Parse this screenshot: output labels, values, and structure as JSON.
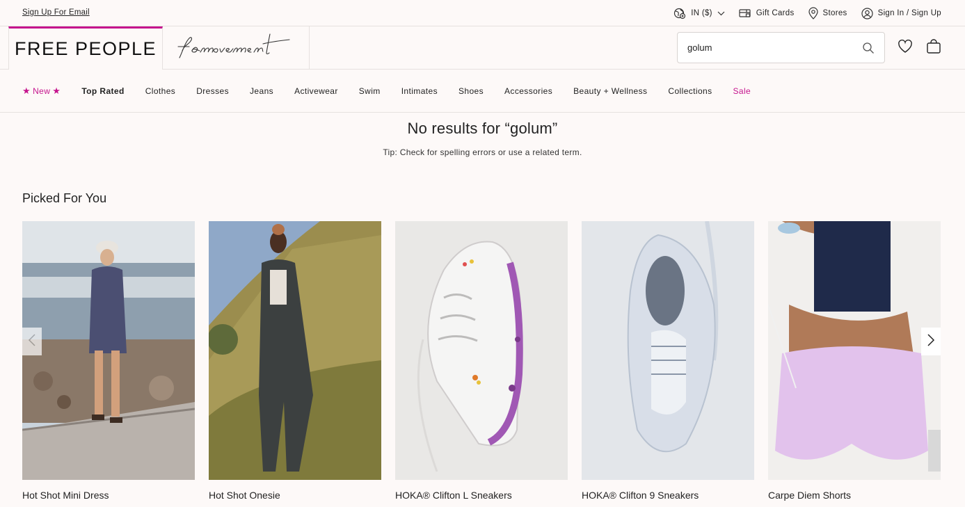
{
  "utility": {
    "signup_label": "Sign Up For Email",
    "region_label": "IN ($)",
    "gift_cards_label": "Gift Cards",
    "stores_label": "Stores",
    "signin_label": "Sign In / Sign Up"
  },
  "header": {
    "logo_text": "FREE PEOPLE",
    "movement_logo_text": "fp movement",
    "search_value": "golum",
    "icons": [
      "globe-icon",
      "gift-card-icon",
      "location-pin-icon",
      "user-icon",
      "search-icon",
      "heart-icon",
      "bag-icon"
    ]
  },
  "nav": {
    "items": [
      {
        "label": "New"
      },
      {
        "label": "Top Rated"
      },
      {
        "label": "Clothes"
      },
      {
        "label": "Dresses"
      },
      {
        "label": "Jeans"
      },
      {
        "label": "Activewear"
      },
      {
        "label": "Swim"
      },
      {
        "label": "Intimates"
      },
      {
        "label": "Shoes"
      },
      {
        "label": "Accessories"
      },
      {
        "label": "Beauty + Wellness"
      },
      {
        "label": "Collections"
      },
      {
        "label": "Sale"
      }
    ]
  },
  "results": {
    "heading": "No results for “golum”",
    "tip": "Tip: Check for spelling errors or use a related term."
  },
  "picked": {
    "title": "Picked For You",
    "products": [
      {
        "name": "Hot Shot Mini Dress"
      },
      {
        "name": "Hot Shot Onesie"
      },
      {
        "name": "HOKA® Clifton L Sneakers"
      },
      {
        "name": "HOKA® Clifton 9 Sneakers"
      },
      {
        "name": "Carpe Diem Shorts"
      }
    ]
  },
  "colors": {
    "accent": "#c5148d",
    "background": "#fdf9f8",
    "text": "#222222"
  }
}
